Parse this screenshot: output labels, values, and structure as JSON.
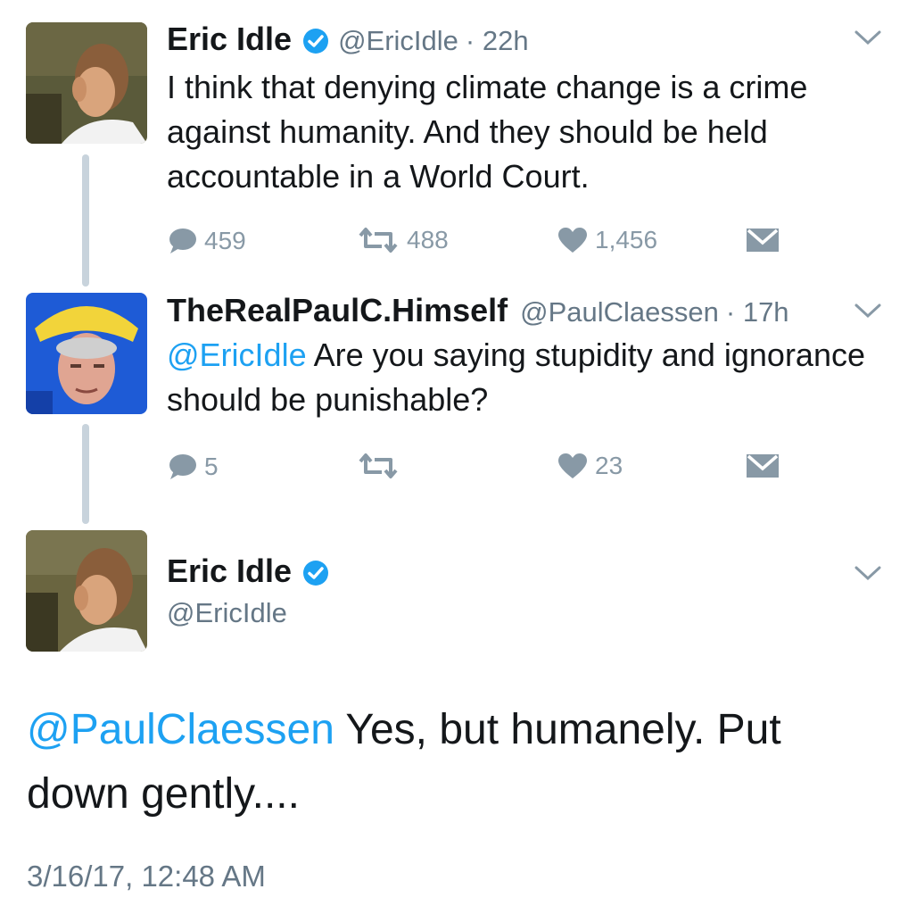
{
  "tweets": [
    {
      "name": "Eric Idle",
      "handle": "@EricIdle",
      "time": "· 22h",
      "text": "I think that denying climate change is a crime against humanity.  And they should be held accountable in a World Court.",
      "replies": "459",
      "retweets": "488",
      "likes": "1,456"
    },
    {
      "name": "TheRealPaulC.Himself",
      "handle": "@PaulClaessen",
      "time": "· 17h",
      "mention": "@EricIdle",
      "text": " Are you saying stupidity and ignorance should be punishable?",
      "replies": "5",
      "retweets": "",
      "likes": "23"
    }
  ],
  "main_tweet": {
    "name": "Eric Idle",
    "handle": "@EricIdle",
    "mention": "@PaulClaessen",
    "text": " Yes, but humanely.  Put down gently....",
    "timestamp": "3/16/17, 12:48 AM"
  },
  "colors": {
    "accent": "#1da1f2",
    "muted": "#8899a6",
    "thread_line": "#c8d3dc"
  },
  "icons": [
    "verified-badge-icon",
    "reply-icon",
    "retweet-icon",
    "like-icon",
    "direct-message-icon",
    "chevron-down-icon"
  ]
}
